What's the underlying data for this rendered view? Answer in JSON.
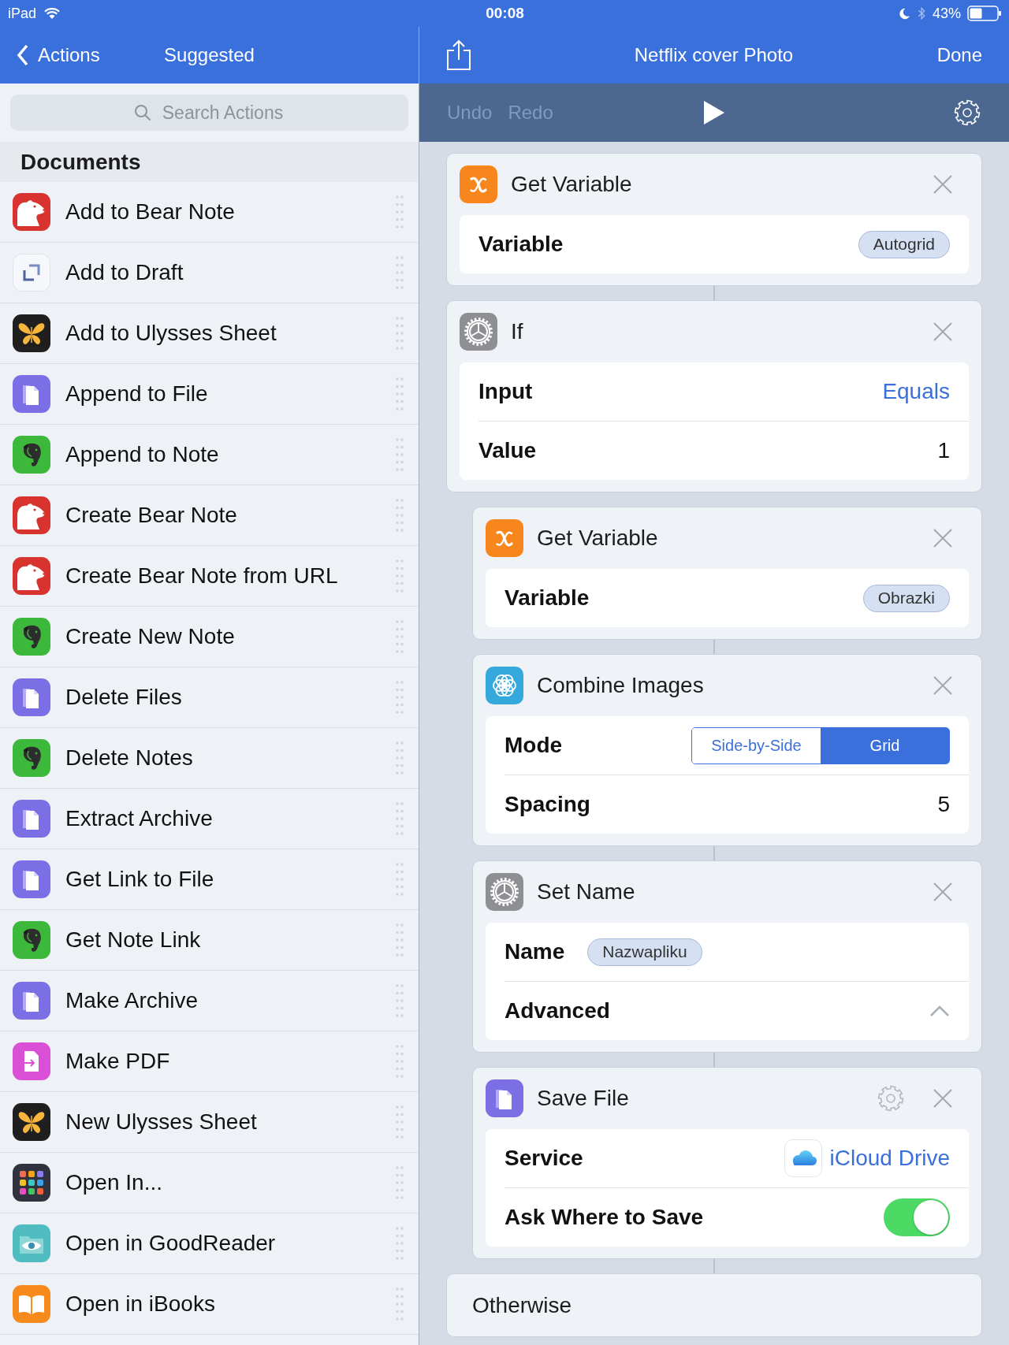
{
  "status_bar": {
    "device": "iPad",
    "time": "00:08",
    "battery": "43%"
  },
  "sidebar": {
    "back": "Actions",
    "title": "Suggested",
    "search": {
      "placeholder": "Search Actions"
    },
    "section": "Documents",
    "items": [
      {
        "label": "Add to Bear Note",
        "kind": "bear"
      },
      {
        "label": "Add to Draft",
        "kind": "drafts"
      },
      {
        "label": "Add to Ulysses Sheet",
        "kind": "ulysses"
      },
      {
        "label": "Append to File",
        "kind": "file"
      },
      {
        "label": "Append to Note",
        "kind": "evernote"
      },
      {
        "label": "Create Bear Note",
        "kind": "bear"
      },
      {
        "label": "Create Bear Note from URL",
        "kind": "bear"
      },
      {
        "label": "Create New Note",
        "kind": "evernote"
      },
      {
        "label": "Delete Files",
        "kind": "file"
      },
      {
        "label": "Delete Notes",
        "kind": "evernote"
      },
      {
        "label": "Extract Archive",
        "kind": "file"
      },
      {
        "label": "Get Link to File",
        "kind": "file"
      },
      {
        "label": "Get Note Link",
        "kind": "evernote"
      },
      {
        "label": "Make Archive",
        "kind": "file"
      },
      {
        "label": "Make PDF",
        "kind": "pdf"
      },
      {
        "label": "New Ulysses Sheet",
        "kind": "ulysses"
      },
      {
        "label": "Open In...",
        "kind": "openin"
      },
      {
        "label": "Open in GoodReader",
        "kind": "goodreader"
      },
      {
        "label": "Open in iBooks",
        "kind": "ibooks"
      }
    ]
  },
  "editor": {
    "title": "Netflix cover Photo",
    "done": "Done",
    "toolbar": {
      "buttons": [
        {
          "label": "Undo",
          "disabled": true
        },
        {
          "label": "Redo",
          "disabled": true
        }
      ]
    },
    "actions": [
      {
        "kind": "variable",
        "title": "Get Variable",
        "settings": false,
        "parameters": [
          {
            "kind": "token",
            "label": "Variable",
            "value": "Autogrid"
          }
        ]
      },
      {
        "kind": "gear",
        "title": "If",
        "settings": false,
        "parameters": [
          {
            "kind": "link",
            "label": "Input",
            "value": "Equals"
          },
          {
            "kind": "text",
            "label": "Value",
            "value": "1"
          }
        ],
        "children": [
          {
            "kind": "variable",
            "title": "Get Variable",
            "settings": false,
            "parameters": [
              {
                "kind": "token",
                "label": "Variable",
                "value": "Obrazki"
              }
            ]
          },
          {
            "kind": "flower",
            "title": "Combine Images",
            "settings": false,
            "parameters": [
              {
                "kind": "segmented",
                "label": "Mode",
                "options": [
                  {
                    "label": "Side-by-Side",
                    "selected": false
                  },
                  {
                    "label": "Grid",
                    "selected": true
                  }
                ]
              },
              {
                "kind": "text",
                "label": "Spacing",
                "value": "5"
              }
            ]
          },
          {
            "kind": "gear",
            "title": "Set Name",
            "settings": false,
            "parameters": [
              {
                "kind": "inline_token",
                "label": "Name",
                "value": "Nazwapliku"
              },
              {
                "kind": "disclosure",
                "label": "Advanced",
                "expanded": false
              }
            ]
          },
          {
            "kind": "file",
            "title": "Save File",
            "settings": true,
            "parameters": [
              {
                "kind": "service",
                "label": "Service",
                "value": "iCloud Drive"
              },
              {
                "kind": "toggle",
                "label": "Ask Where to Save",
                "on": true
              }
            ]
          }
        ]
      },
      {
        "kind": "branch",
        "title": "Otherwise"
      }
    ]
  }
}
